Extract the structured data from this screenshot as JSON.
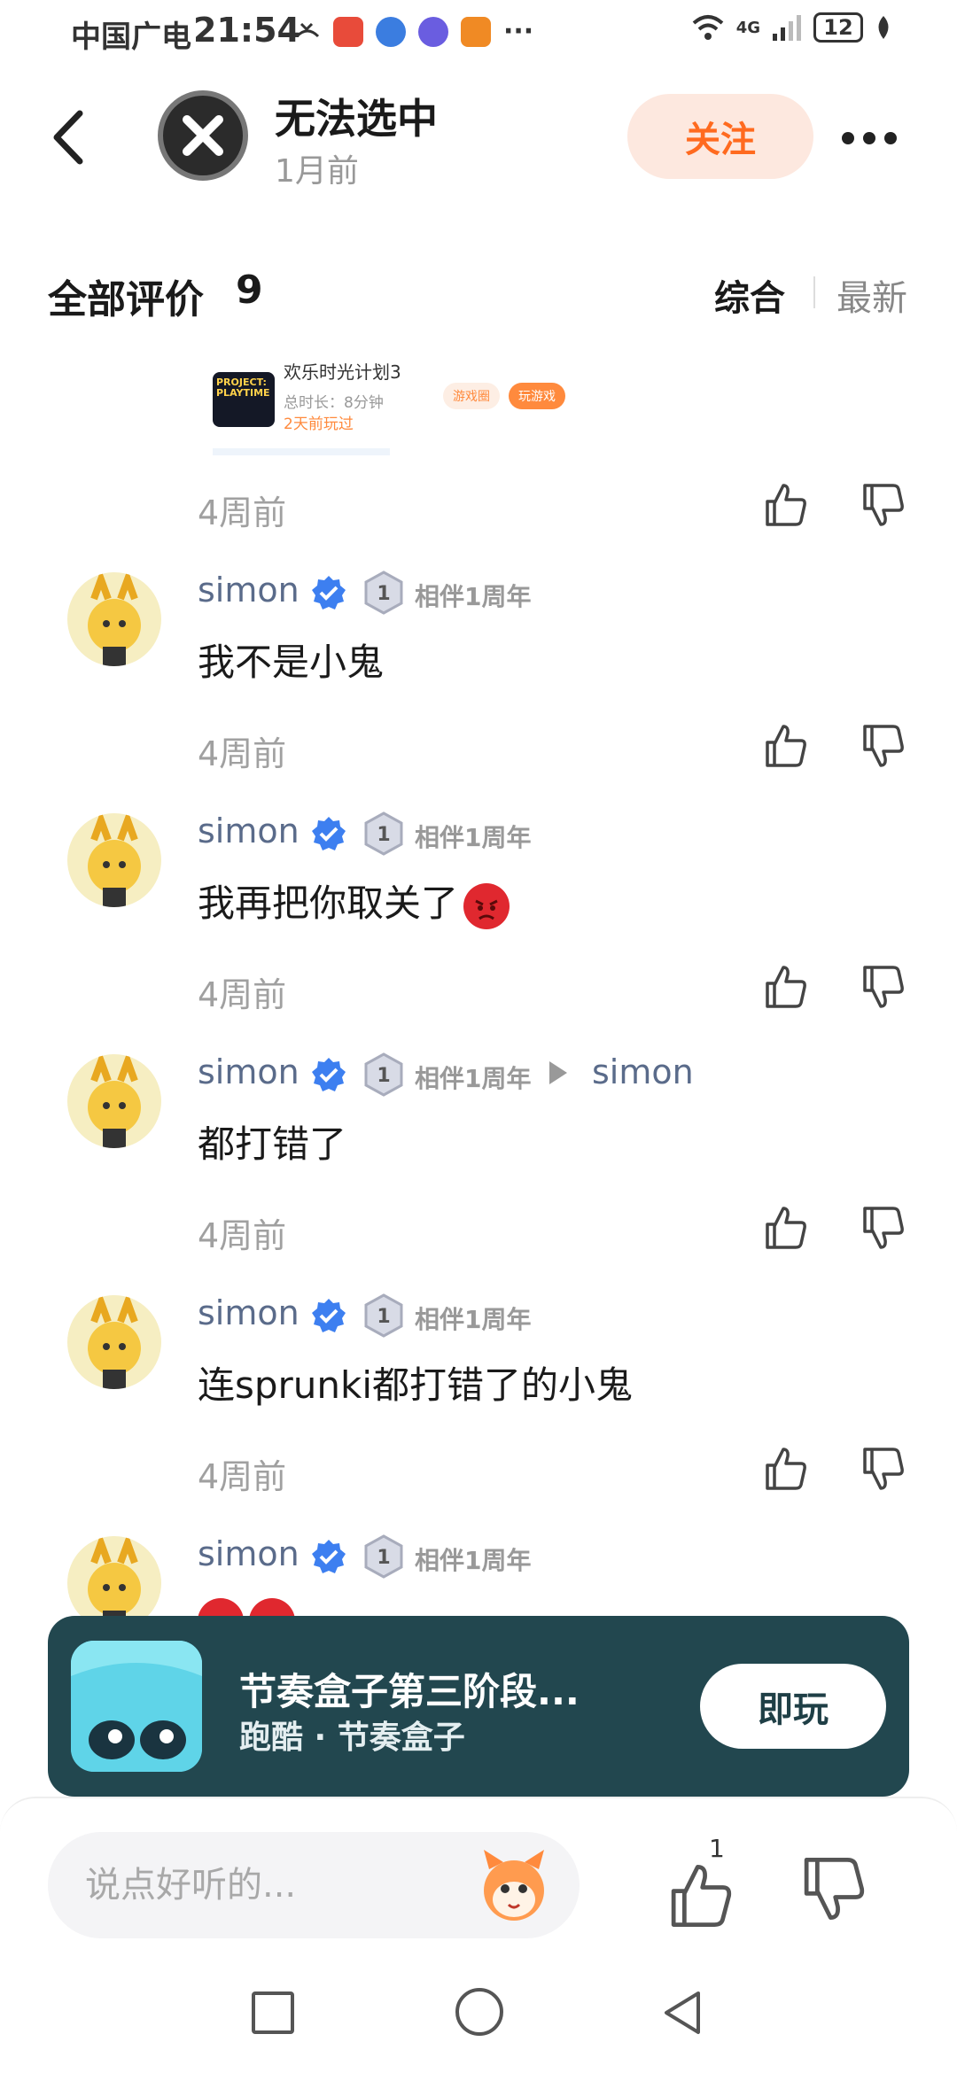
{
  "status_bar": {
    "carrier": "中国广电",
    "time": "21:54",
    "network": "4G",
    "battery": "12"
  },
  "header": {
    "poster_name": "无法选中",
    "poster_time": "1月前",
    "follow_label": "关注"
  },
  "reviews": {
    "title": "全部评价",
    "count": "9",
    "sort_composite": "综合",
    "sort_latest": "最新"
  },
  "embed": {
    "thumb_text": "PROJECT: PLAYTIME",
    "title": "欢乐时光计划3",
    "duration": "总时长：8分钟",
    "played": "2天前玩过",
    "tag1": "游戏圈",
    "tag2": "玩游戏"
  },
  "comments": [
    {
      "time": "4周前"
    },
    {
      "name": "simon",
      "badge": "相伴1周年",
      "text": "我不是小鬼",
      "time": "4周前"
    },
    {
      "name": "simon",
      "badge": "相伴1周年",
      "text": "我再把你取关了",
      "emoji": "angry-face",
      "time": "4周前"
    },
    {
      "name": "simon",
      "badge": "相伴1周年",
      "reply_to": "simon",
      "text": "都打错了",
      "time": "4周前"
    },
    {
      "name": "simon",
      "badge": "相伴1周年",
      "text": "连sprunki都打错了的小鬼",
      "time": "4周前"
    },
    {
      "name": "simon",
      "badge": "相伴1周年",
      "emoji": "angry-face"
    }
  ],
  "game_banner": {
    "title": "节奏盒子第三阶段...",
    "subtitle": "跑酷 · 节奏盒子",
    "play_label": "即玩"
  },
  "input_bar": {
    "placeholder": "说点好听的...",
    "like_count": "1"
  },
  "colors": {
    "accent": "#ff6a1f",
    "follow_bg": "#fde8df",
    "banner_bg": "#22474f",
    "username": "#5a6b8a",
    "verified": "#3d7ff0"
  }
}
